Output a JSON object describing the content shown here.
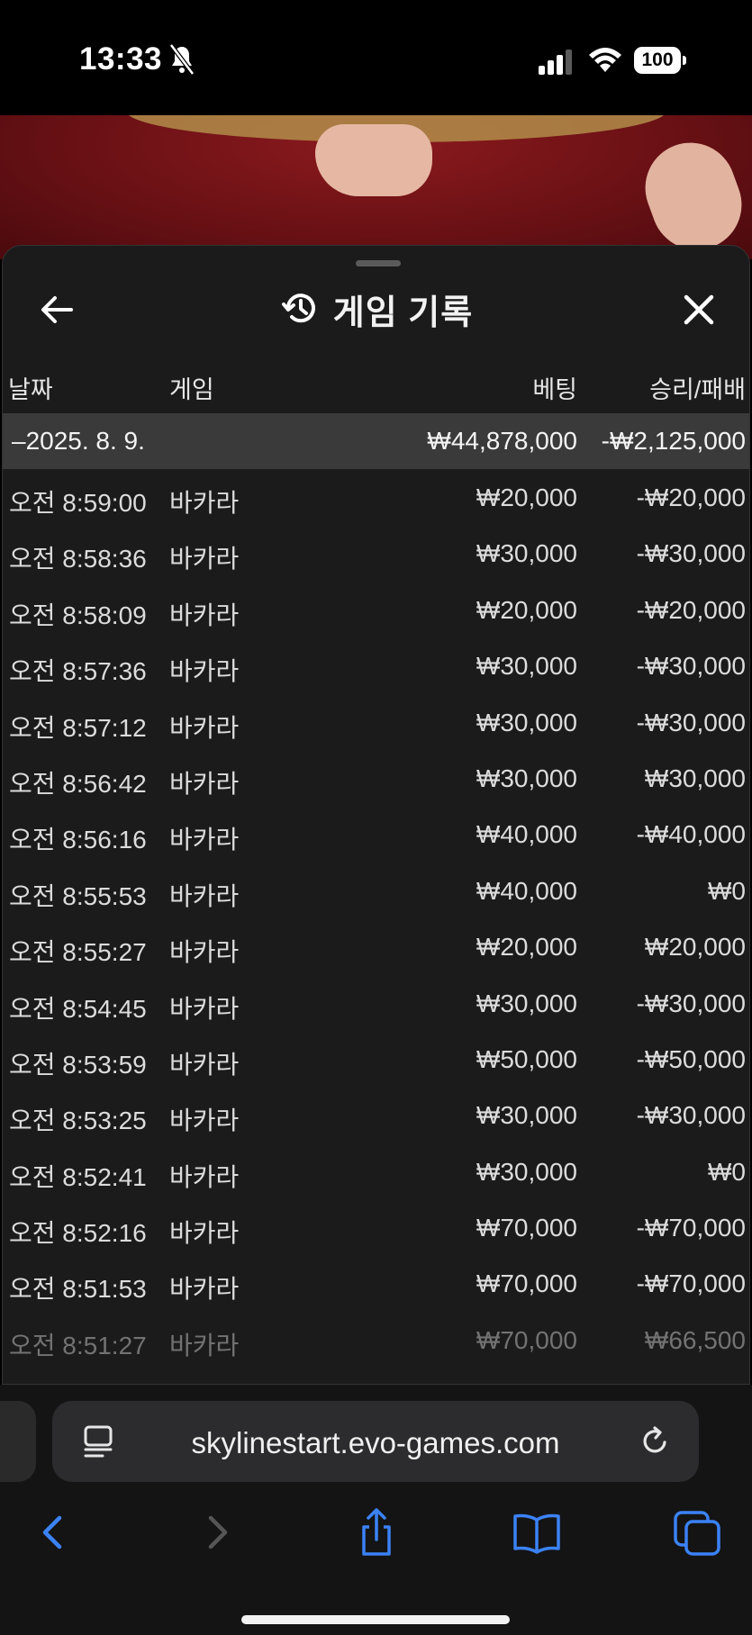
{
  "status_bar": {
    "time": "13:33",
    "battery": "100"
  },
  "panel": {
    "title": "게임 기록",
    "columns": [
      "날짜",
      "게임",
      "베팅",
      "승리/패배"
    ],
    "date_group": {
      "date": "–2025. 8. 9.",
      "total_bet": "₩44,878,000",
      "total_result": "-₩2,125,000"
    },
    "rows": [
      {
        "time": "오전 8:59:00",
        "game": "바카라",
        "bet": "₩20,000",
        "result": "-₩20,000"
      },
      {
        "time": "오전 8:58:36",
        "game": "바카라",
        "bet": "₩30,000",
        "result": "-₩30,000"
      },
      {
        "time": "오전 8:58:09",
        "game": "바카라",
        "bet": "₩20,000",
        "result": "-₩20,000"
      },
      {
        "time": "오전 8:57:36",
        "game": "바카라",
        "bet": "₩30,000",
        "result": "-₩30,000"
      },
      {
        "time": "오전 8:57:12",
        "game": "바카라",
        "bet": "₩30,000",
        "result": "-₩30,000"
      },
      {
        "time": "오전 8:56:42",
        "game": "바카라",
        "bet": "₩30,000",
        "result": "₩30,000"
      },
      {
        "time": "오전 8:56:16",
        "game": "바카라",
        "bet": "₩40,000",
        "result": "-₩40,000"
      },
      {
        "time": "오전 8:55:53",
        "game": "바카라",
        "bet": "₩40,000",
        "result": "₩0"
      },
      {
        "time": "오전 8:55:27",
        "game": "바카라",
        "bet": "₩20,000",
        "result": "₩20,000"
      },
      {
        "time": "오전 8:54:45",
        "game": "바카라",
        "bet": "₩30,000",
        "result": "-₩30,000"
      },
      {
        "time": "오전 8:53:59",
        "game": "바카라",
        "bet": "₩50,000",
        "result": "-₩50,000"
      },
      {
        "time": "오전 8:53:25",
        "game": "바카라",
        "bet": "₩30,000",
        "result": "-₩30,000"
      },
      {
        "time": "오전 8:52:41",
        "game": "바카라",
        "bet": "₩30,000",
        "result": "₩0"
      },
      {
        "time": "오전 8:52:16",
        "game": "바카라",
        "bet": "₩70,000",
        "result": "-₩70,000"
      },
      {
        "time": "오전 8:51:53",
        "game": "바카라",
        "bet": "₩70,000",
        "result": "-₩70,000"
      },
      {
        "time": "오전 8:51:27",
        "game": "바카라",
        "bet": "₩70,000",
        "result": "₩66,500"
      }
    ]
  },
  "browser": {
    "url": "skylinestart.evo-games.com",
    "accent_color": "#3b82f6"
  }
}
